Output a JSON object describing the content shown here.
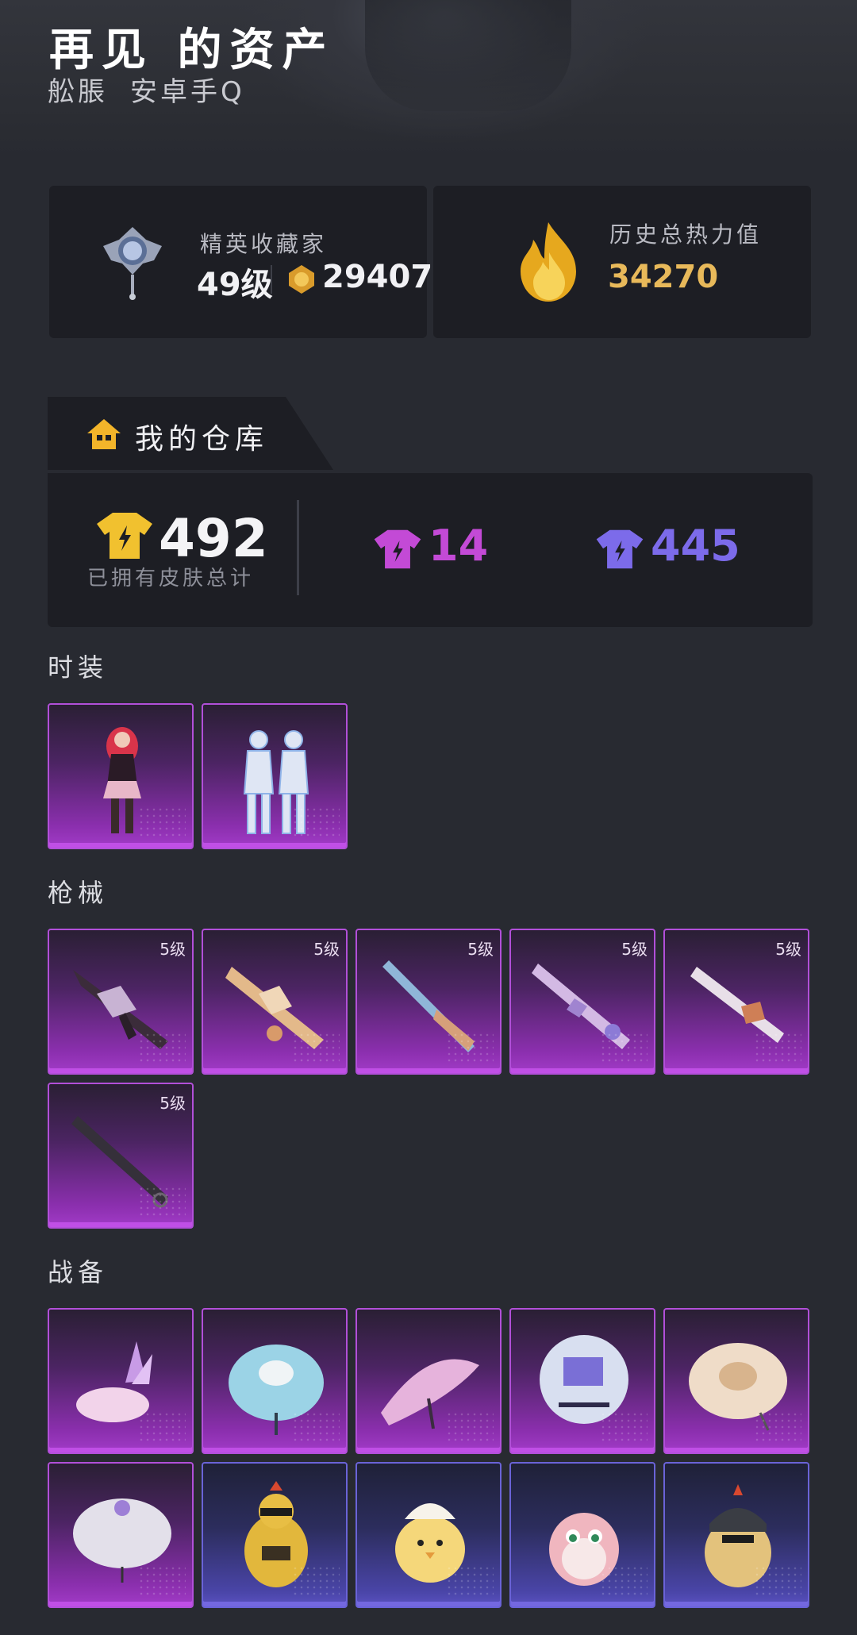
{
  "header": {
    "title": "再见 的资产",
    "subtitle_parts": [
      "舩脹",
      "安卓手Q"
    ]
  },
  "collector": {
    "rank_label": "精英收藏家",
    "level": "49级",
    "points": "29407"
  },
  "heat": {
    "label": "历史总热力值",
    "value": "34270"
  },
  "warehouse": {
    "tab_label": "我的仓库",
    "total": "492",
    "total_caption": "已拥有皮肤总计",
    "purple_count": "14",
    "blue_count": "445"
  },
  "sections": {
    "fashion": "时装",
    "guns": "枪械",
    "gear": "战备"
  },
  "gun_level_tags": [
    "5级",
    "5级",
    "5级",
    "5级",
    "5级",
    "5级"
  ],
  "colors": {
    "background": "#282a31",
    "card": "#1d1e24",
    "purple": "#c34ad6",
    "blue": "#7c6bea",
    "gold": "#e8b95a"
  },
  "icons": [
    "collector-badge-icon",
    "coin-icon",
    "flame-icon",
    "home-icon",
    "tshirt-icon"
  ]
}
